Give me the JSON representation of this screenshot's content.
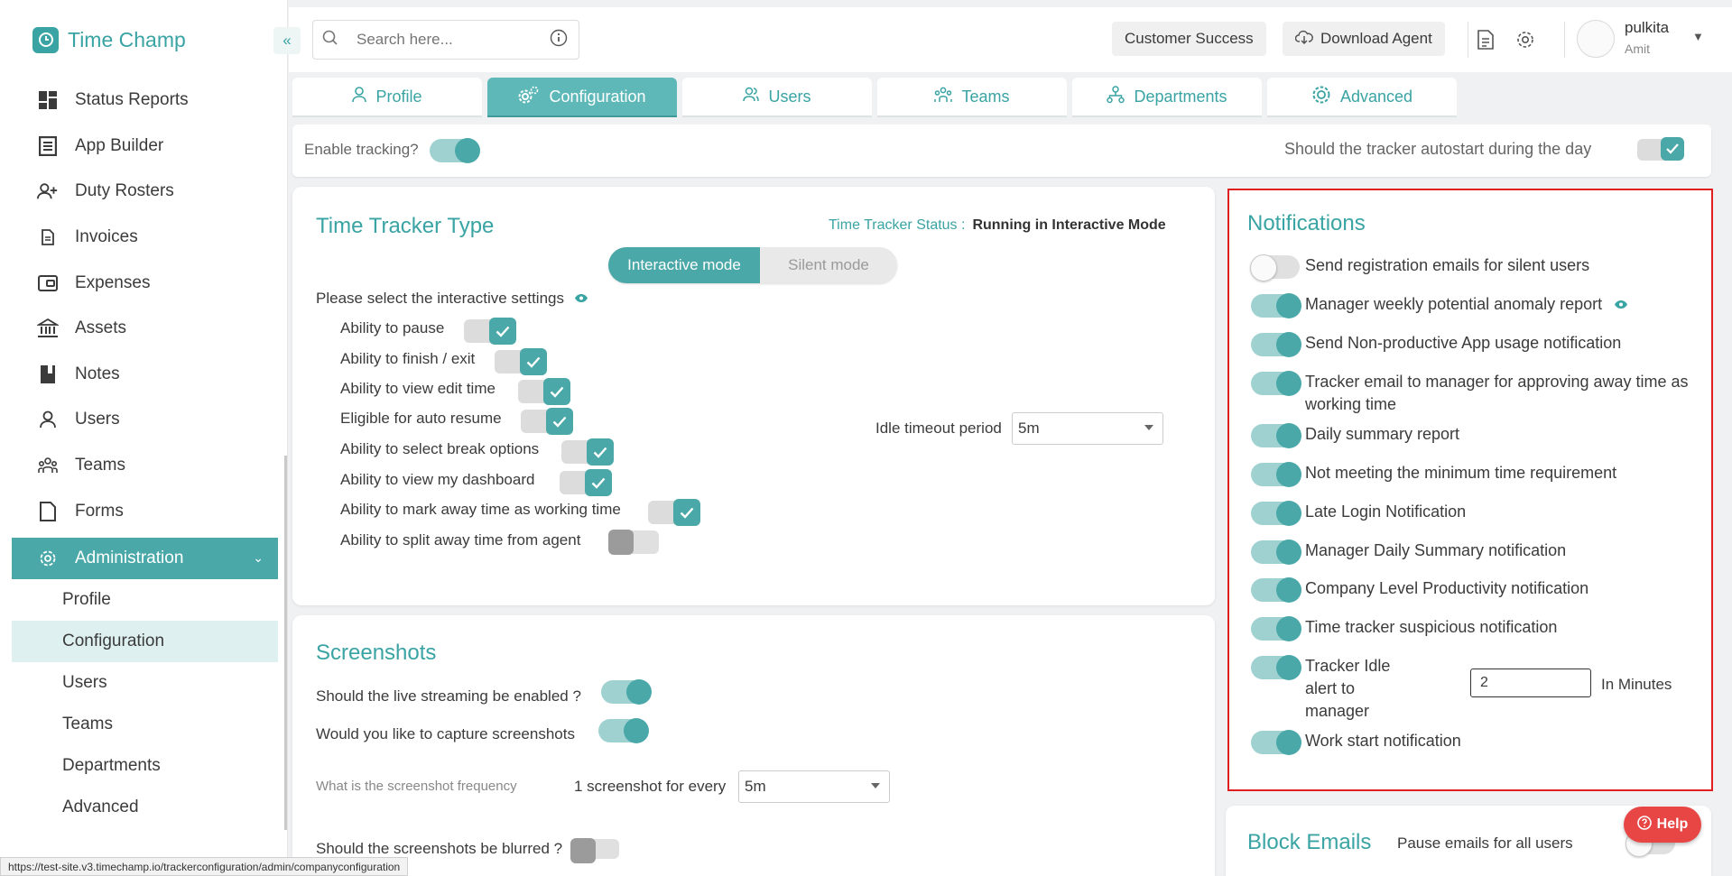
{
  "app": {
    "name": "Time Champ"
  },
  "sidebar": {
    "items": [
      {
        "label": "Status Reports",
        "icon": "dashboard-icon"
      },
      {
        "label": "App Builder",
        "icon": "app-builder-icon"
      },
      {
        "label": "Duty Rosters",
        "icon": "duty-roster-icon"
      },
      {
        "label": "Invoices",
        "icon": "invoice-icon"
      },
      {
        "label": "Expenses",
        "icon": "wallet-icon"
      },
      {
        "label": "Assets",
        "icon": "bank-icon"
      },
      {
        "label": "Notes",
        "icon": "notebook-icon"
      },
      {
        "label": "Users",
        "icon": "user-icon"
      },
      {
        "label": "Teams",
        "icon": "teams-icon"
      },
      {
        "label": "Forms",
        "icon": "form-icon"
      }
    ],
    "admin_label": "Administration",
    "sub_items": [
      "Profile",
      "Configuration",
      "Users",
      "Teams",
      "Departments",
      "Advanced"
    ],
    "selected_sub": "Configuration"
  },
  "status_url": "https://test-site.v3.timechamp.io/trackerconfiguration/admin/companyconfiguration",
  "topbar": {
    "search_placeholder": "Search here...",
    "customer_success": "Customer Success",
    "download_agent": "Download Agent",
    "user_name": "pulkita",
    "user_sub": "Amit"
  },
  "tabs": [
    "Profile",
    "Configuration",
    "Users",
    "Teams",
    "Departments",
    "Advanced"
  ],
  "active_tab": "Configuration",
  "tracking": {
    "enable_label": "Enable tracking?",
    "enable_on": true,
    "autostart_label": "Should the tracker autostart during the day",
    "autostart_on": true
  },
  "time_tracker": {
    "title": "Time Tracker Type",
    "status_label": "Time Tracker Status :",
    "status_value": "Running in Interactive Mode",
    "modes": [
      "Interactive mode",
      "Silent mode"
    ],
    "active_mode": "Interactive mode",
    "settings_label": "Please select the interactive settings",
    "settings": [
      {
        "label": "Ability to pause",
        "on": true
      },
      {
        "label": "Ability to finish / exit",
        "on": true
      },
      {
        "label": "Ability to view edit time",
        "on": true
      },
      {
        "label": "Eligible for auto resume",
        "on": true
      },
      {
        "label": "Ability to select break options",
        "on": true
      },
      {
        "label": "Ability to view my dashboard",
        "on": true
      },
      {
        "label": "Ability to mark away time as working time",
        "on": true
      },
      {
        "label": "Ability to split away time from agent",
        "on": false
      }
    ],
    "idle_label": "Idle timeout period",
    "idle_value": "5m"
  },
  "screenshots": {
    "title": "Screenshots",
    "live_label": "Should the live streaming be enabled ?",
    "live_on": true,
    "capture_label": "Would you like to capture screenshots",
    "capture_on": true,
    "freq_label": "What is the screenshot frequency",
    "freq_prefix": "1 screenshot for every",
    "freq_value": "5m",
    "blur_label": "Should the screenshots be blurred ?",
    "blur_on": false
  },
  "notifications": {
    "title": "Notifications",
    "items": [
      {
        "label": "Send registration emails for silent users",
        "on": false
      },
      {
        "label": "Manager weekly potential anomaly report",
        "on": true
      },
      {
        "label": "Send Non-productive App usage notification",
        "on": true
      },
      {
        "label": "Tracker email to manager for approving away time as working time",
        "on": true
      },
      {
        "label": "Daily summary report",
        "on": true
      },
      {
        "label": "Not meeting the minimum time requirement",
        "on": true
      },
      {
        "label": "Late Login Notification",
        "on": true
      },
      {
        "label": "Manager Daily Summary notification",
        "on": true
      },
      {
        "label": "Company Level Productivity notification",
        "on": true
      },
      {
        "label": "Time tracker suspicious notification",
        "on": true
      },
      {
        "label": "Tracker Idle alert to manager",
        "on": true
      },
      {
        "label": "Work start notification",
        "on": true
      }
    ],
    "idle_alert_value": "2",
    "idle_alert_unit": "In Minutes"
  },
  "block_emails": {
    "title": "Block Emails",
    "pause_label": "Pause emails for all users",
    "pause_on": false
  },
  "help_label": "Help",
  "colors": {
    "accent": "#4aa8a8",
    "brand": "#3aa3a3",
    "highlight_border": "#e02020",
    "help": "#e84545"
  }
}
